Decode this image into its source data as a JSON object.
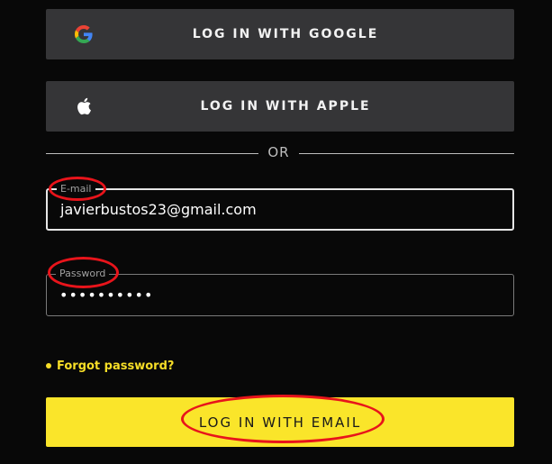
{
  "buttons": {
    "google_label": "LOG IN WITH GOOGLE",
    "apple_label": "LOG IN WITH APPLE",
    "email_login_label": "LOG IN WITH EMAIL"
  },
  "divider": {
    "text": "OR"
  },
  "email": {
    "label": "E-mail",
    "value": "javierbustos23@gmail.com"
  },
  "password": {
    "label": "Password",
    "value": "••••••••••"
  },
  "forgot_password": {
    "label": "Forgot password?"
  },
  "icons": {
    "google": "google-icon",
    "apple": "apple-icon"
  },
  "colors": {
    "background": "#080808",
    "social_button": "#353537",
    "accent_yellow": "#fae52a",
    "link_yellow": "#f7de27",
    "annotation_red": "#e8141b"
  }
}
